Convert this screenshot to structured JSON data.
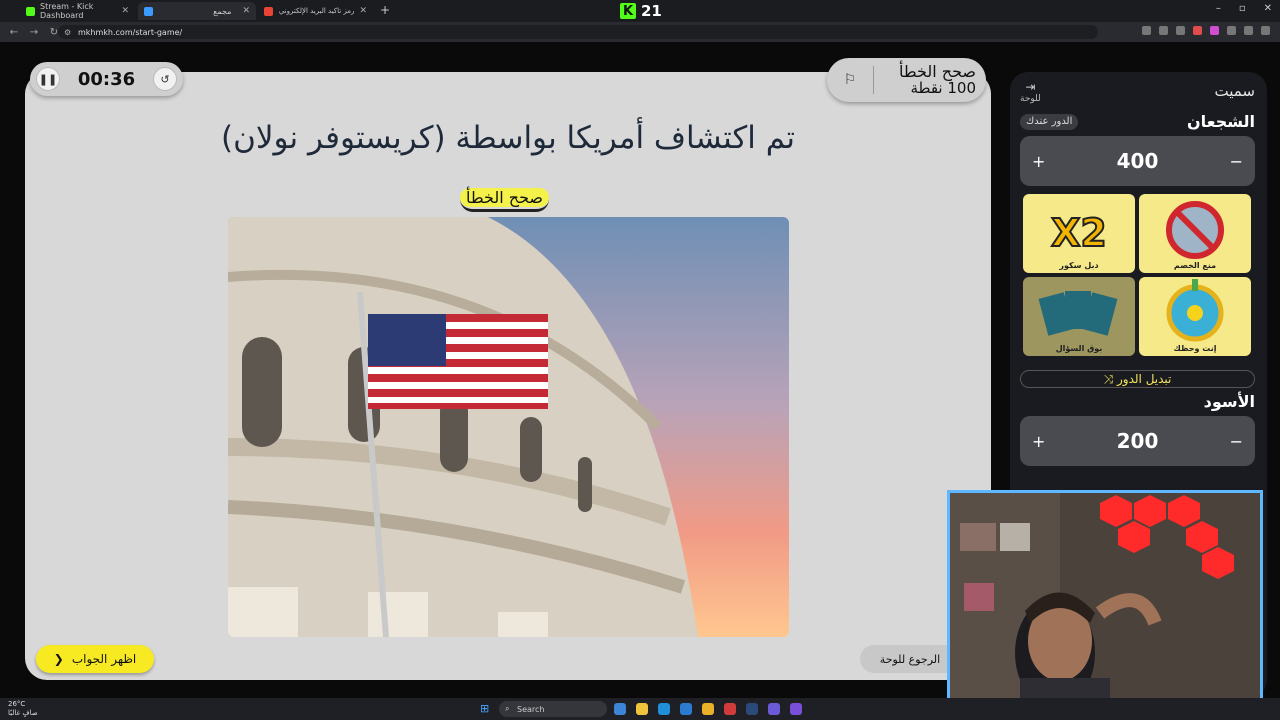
{
  "browser": {
    "tabs": [
      {
        "title": "Stream - Kick Dashboard",
        "favicon_color": "#53fc18",
        "active": false
      },
      {
        "title": "مجمع",
        "favicon_color": "#3b9cff",
        "active": true
      },
      {
        "title": "رمز تأكيد البريد الإلكتروني - محمد",
        "favicon_color": "#ea4335",
        "active": false
      }
    ],
    "new_tab": "+",
    "url": "mkhmkh.com/start-game/",
    "kick_count": "21",
    "kick_letter": "K"
  },
  "game": {
    "timer": "00:36",
    "mode_title": "صحح الخطأ",
    "mode_points": "100 نقطة",
    "question": "تم اكتشاف أمريكا بواسطة (كريستوفر نولان)",
    "category": "صحح الخطأ",
    "show_answer_label": "اظهر الجواب",
    "back_to_board_label": "الرجوع للوحة"
  },
  "sidebar": {
    "session_name": "سميت",
    "board_link": "للوحة",
    "turn_badge": "الدور عندك",
    "switch_turn_label": "تبديل الدور",
    "teams": [
      {
        "name": "الشجعان",
        "score": "400",
        "helpers": [
          {
            "label": "منع الخصم",
            "icon": "block-opponent-icon"
          },
          {
            "label": "دبل سكور",
            "icon": "double-score-icon"
          },
          {
            "label": "إنت وحظك",
            "icon": "luck-wheel-icon"
          },
          {
            "label": "بوق السؤال",
            "icon": "cards-icon"
          }
        ]
      },
      {
        "name": "الأسود",
        "score": "200"
      }
    ],
    "plus": "+",
    "minus": "−"
  },
  "taskbar": {
    "weather_temp": "26°C",
    "weather_desc": "صافٍ غالبًا",
    "search_placeholder": "Search"
  }
}
